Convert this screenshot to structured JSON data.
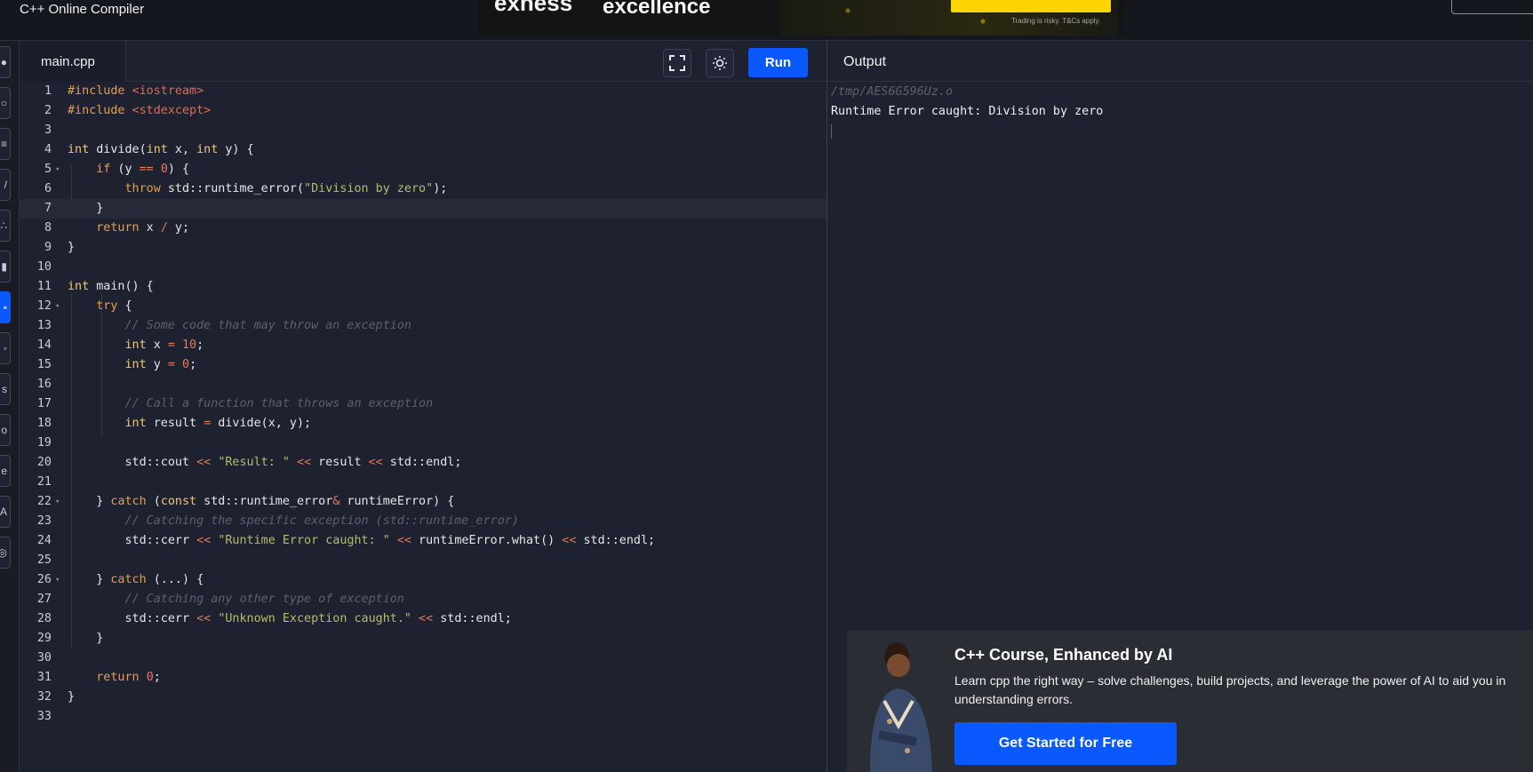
{
  "app": {
    "title": "C++ Online Compiler"
  },
  "ad": {
    "word1": "exness",
    "word2": "excellence",
    "note": "Trading is risky. T&Cs apply."
  },
  "rail": {
    "icons": [
      "cpp-icon",
      "search-icon",
      "list-icon",
      "pen-icon",
      "sliders-icon",
      "book-icon",
      "code-icon",
      "chat-icon",
      "share-icon",
      "bulb-icon",
      "gear-icon",
      "font-icon",
      "help-icon"
    ]
  },
  "editor": {
    "file_tab": "main.cpp",
    "run_label": "Run",
    "lines": [
      "1",
      "2",
      "3",
      "4",
      "5",
      "6",
      "7",
      "8",
      "9",
      "10",
      "11",
      "12",
      "13",
      "14",
      "15",
      "16",
      "17",
      "18",
      "19",
      "20",
      "21",
      "22",
      "23",
      "24",
      "25",
      "26",
      "27",
      "28",
      "29",
      "30",
      "31",
      "32",
      "33"
    ]
  },
  "output": {
    "title": "Output",
    "path": "/tmp/AES6G596Uz.o",
    "text": "Runtime Error caught: Division by zero"
  },
  "promo": {
    "title": "C++ Course, Enhanced by AI",
    "description": "Learn cpp the right way – solve challenges, build projects, and leverage the power of AI to aid you in understanding errors.",
    "cta": "Get Started for Free"
  },
  "colors": {
    "accent": "#0a58ff",
    "editor_bg": "#1e2130",
    "keyword": "#f0c674",
    "string": "#b5bd68",
    "number": "#e57a5a",
    "comment": "#5c6070"
  }
}
